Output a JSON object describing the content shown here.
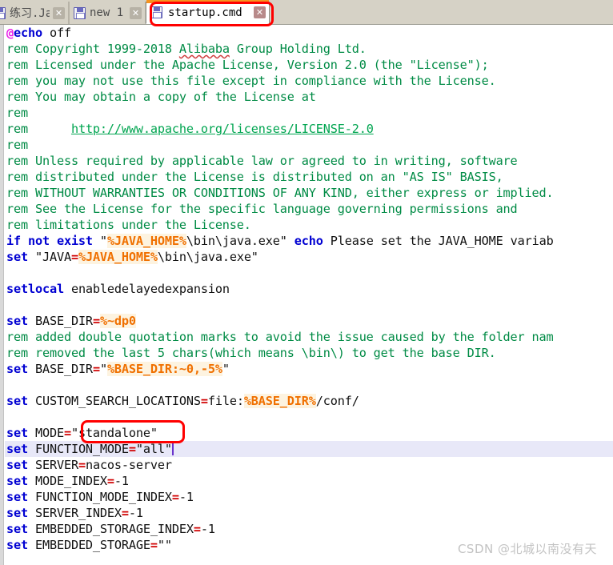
{
  "window": {
    "title": "startup.cmd",
    "app_kind": "text-editor"
  },
  "tabs": [
    {
      "label": "练习.Java",
      "close": "✕",
      "active": false,
      "icon": "save-disk-icon"
    },
    {
      "label": "new  1",
      "close": "✕",
      "active": false,
      "icon": "save-disk-icon"
    },
    {
      "label": "startup.cmd",
      "close": "✕",
      "active": true,
      "icon": "save-disk-icon"
    }
  ],
  "annotations": {
    "tab_box_color": "#ff0000",
    "mode_box_color": "#ff0000",
    "tab_box_target": "startup.cmd",
    "mode_box_target": "\"standalone\""
  },
  "colors": {
    "keyword": "#0000d2",
    "comment": "#00a550",
    "variable": "#f07000",
    "variable_bg": "#fdf3e0",
    "equals": "#d00000",
    "at_sign": "#e81ee8",
    "current_line_bg": "#e8e8f8",
    "caret": "#6a33cc",
    "tabbar_bg": "#d6d2c6",
    "tab_accent": "#f59320"
  },
  "editor": {
    "current_line_index": 30,
    "caret_after": "set FUNCTION_MODE=\"all\"",
    "lines": [
      {
        "i": 0,
        "t": "at-echo",
        "a": "@",
        "b": "echo",
        "c": " off"
      },
      {
        "i": 1,
        "t": "rem",
        "text": "rem Copyright 1999-2018 Alibaba Group Holding Ltd.",
        "squiggle": "Alibaba"
      },
      {
        "i": 2,
        "t": "rem",
        "text": "rem Licensed under the Apache License, Version 2.0 (the \"License\");"
      },
      {
        "i": 3,
        "t": "rem",
        "text": "rem you may not use this file except in compliance with the License."
      },
      {
        "i": 4,
        "t": "rem",
        "text": "rem You may obtain a copy of the License at"
      },
      {
        "i": 5,
        "t": "rem",
        "text": "rem"
      },
      {
        "i": 6,
        "t": "rem-link",
        "pre": "rem      ",
        "link": "http://www.apache.org/licenses/LICENSE-2.0"
      },
      {
        "i": 7,
        "t": "rem",
        "text": "rem"
      },
      {
        "i": 8,
        "t": "rem",
        "text": "rem Unless required by applicable law or agreed to in writing, software"
      },
      {
        "i": 9,
        "t": "rem",
        "text": "rem distributed under the License is distributed on an \"AS IS\" BASIS,"
      },
      {
        "i": 10,
        "t": "rem",
        "text": "rem WITHOUT WARRANTIES OR CONDITIONS OF ANY KIND, either express or implied."
      },
      {
        "i": 11,
        "t": "rem",
        "text": "rem See the License for the specific language governing permissions and"
      },
      {
        "i": 12,
        "t": "rem",
        "text": "rem limitations under the License."
      },
      {
        "i": 13,
        "t": "if",
        "kw": "if not exist",
        "q1": " \"",
        "var": "%JAVA_HOME%",
        "mid": "\\bin\\java.exe\" ",
        "kw2": "echo",
        "tail": " Please set the JAVA_HOME variab"
      },
      {
        "i": 14,
        "t": "setjava",
        "kw": "set",
        "pre": " \"JAVA",
        "eq": "=",
        "var": "%JAVA_HOME%",
        "tail": "\\bin\\java.exe\""
      },
      {
        "i": 15,
        "t": "blank",
        "text": ""
      },
      {
        "i": 16,
        "t": "setlocal",
        "kw": "setlocal",
        "tail": " enabledelayedexpansion"
      },
      {
        "i": 17,
        "t": "blank",
        "text": ""
      },
      {
        "i": 18,
        "t": "setvar",
        "kw": "set",
        "name": " BASE_DIR",
        "eq": "=",
        "var": "%~dp0",
        "tail": ""
      },
      {
        "i": 19,
        "t": "rem",
        "text": "rem added double quotation marks to avoid the issue caused by the folder nam"
      },
      {
        "i": 20,
        "t": "rem",
        "text": "rem removed the last 5 chars(which means \\bin\\) to get the base DIR."
      },
      {
        "i": 21,
        "t": "setvar",
        "kw": "set",
        "name": " BASE_DIR",
        "eq": "=",
        "q1": "\"",
        "var": "%BASE_DIR:~0,-5%",
        "tail": "\""
      },
      {
        "i": 22,
        "t": "blank",
        "text": ""
      },
      {
        "i": 23,
        "t": "setvar",
        "kw": "set",
        "name": " CUSTOM_SEARCH_LOCATIONS",
        "eq": "=",
        "pre": "file:",
        "var": "%BASE_DIR%",
        "tail": "/conf/"
      },
      {
        "i": 24,
        "t": "blank",
        "text": ""
      },
      {
        "i": 25,
        "t": "setplain",
        "kw": "set",
        "name": " MODE",
        "eq": "=",
        "val": "\"standalone\""
      },
      {
        "i": 26,
        "t": "setplain",
        "kw": "set",
        "name": " FUNCTION_MODE",
        "eq": "=",
        "val": "\"all\"",
        "current": true
      },
      {
        "i": 27,
        "t": "setplain",
        "kw": "set",
        "name": " SERVER",
        "eq": "=",
        "val": "nacos-server"
      },
      {
        "i": 28,
        "t": "setplain",
        "kw": "set",
        "name": " MODE_INDEX",
        "eq": "=",
        "val": "-1"
      },
      {
        "i": 29,
        "t": "setplain",
        "kw": "set",
        "name": " FUNCTION_MODE_INDEX",
        "eq": "=",
        "val": "-1"
      },
      {
        "i": 30,
        "t": "setplain",
        "kw": "set",
        "name": " SERVER_INDEX",
        "eq": "=",
        "val": "-1"
      },
      {
        "i": 31,
        "t": "setplain",
        "kw": "set",
        "name": " EMBEDDED_STORAGE_INDEX",
        "eq": "=",
        "val": "-1"
      },
      {
        "i": 32,
        "t": "setplain",
        "kw": "set",
        "name": " EMBEDDED_STORAGE",
        "eq": "=",
        "val": "\"\""
      }
    ]
  },
  "watermark": {
    "text": "CSDN @北城以南没有天"
  }
}
